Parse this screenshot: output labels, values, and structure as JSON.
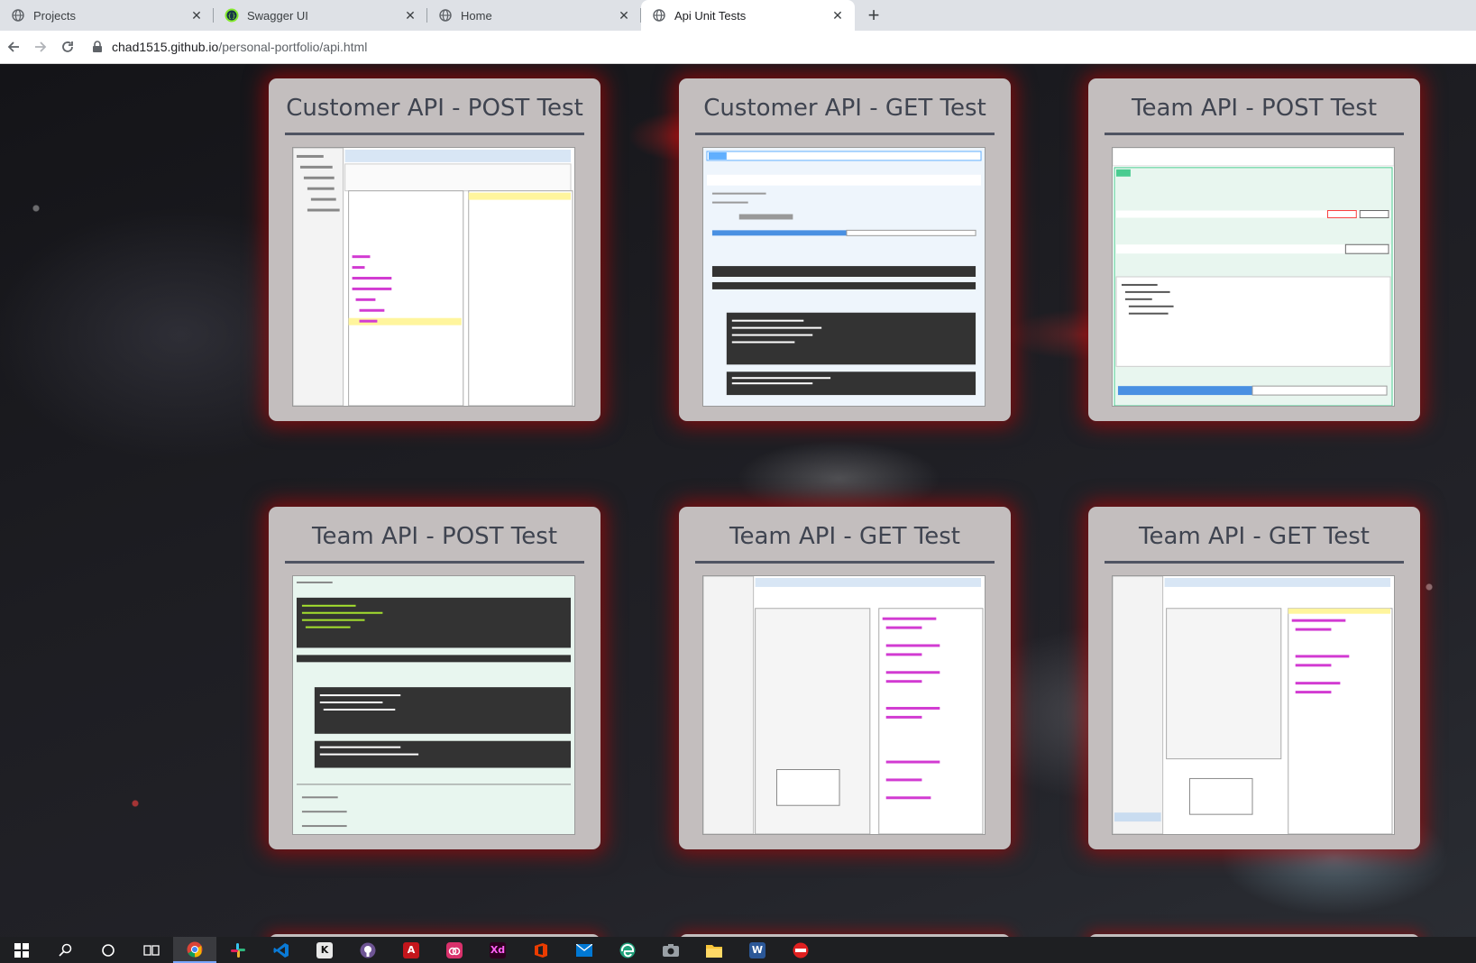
{
  "browser": {
    "tabs": [
      {
        "label": "Projects",
        "icon": "globe-icon",
        "active": false
      },
      {
        "label": "Swagger UI",
        "icon": "swagger-icon",
        "active": false
      },
      {
        "label": "Home",
        "icon": "globe-icon",
        "active": false
      },
      {
        "label": "Api Unit Tests",
        "icon": "globe-icon",
        "active": true
      }
    ],
    "tab_close_glyph": "✕",
    "new_tab_glyph": "+",
    "url_host": "chad1515.github.io",
    "url_path": "/personal-portfolio/api.html"
  },
  "cards": [
    {
      "title": "Customer API - POST Test"
    },
    {
      "title": "Customer API - GET Test"
    },
    {
      "title": "Team API - POST Test"
    },
    {
      "title": "Team API - POST Test"
    },
    {
      "title": "Team API - GET Test"
    },
    {
      "title": "Team API - GET Test"
    }
  ],
  "taskbar": {
    "items": [
      "windows-start-icon",
      "search-icon",
      "cortana-icon",
      "task-view-icon",
      "chrome-icon",
      "slack-icon",
      "vscode-icon",
      "inkscape-icon",
      "github-icon",
      "acrobat-icon",
      "creative-cloud-icon",
      "adobe-xd-icon",
      "office-icon",
      "mail-icon",
      "edge-icon",
      "camera-icon",
      "file-explorer-icon",
      "word-icon",
      "app-icon"
    ],
    "xd_label": "Xd",
    "word_label": "W"
  },
  "colors": {
    "card_bg": "#c3bebe",
    "card_title": "#3f4450",
    "card_glow": "#c80000",
    "tabstrip_bg": "#dee1e6"
  }
}
